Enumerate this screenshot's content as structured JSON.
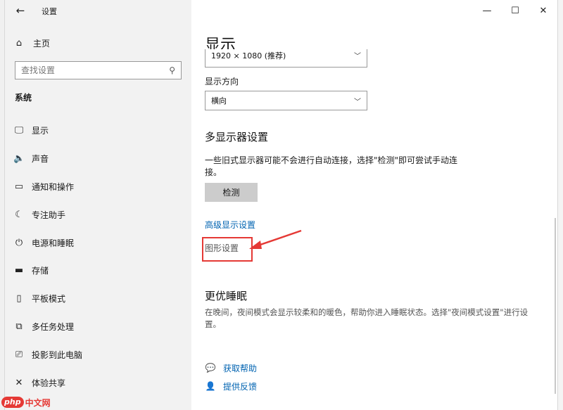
{
  "window": {
    "title": "设置"
  },
  "controls": {
    "minimize": "—",
    "maximize": "☐",
    "close": "✕"
  },
  "sidebar": {
    "home_label": "主页",
    "search_placeholder": "查找设置",
    "section": "系统",
    "items": [
      {
        "label": "显示",
        "icon": "monitor-icon",
        "glyph": "🖵"
      },
      {
        "label": "声音",
        "icon": "speaker-icon",
        "glyph": "🔈"
      },
      {
        "label": "通知和操作",
        "icon": "notification-icon",
        "glyph": "▭"
      },
      {
        "label": "专注助手",
        "icon": "moon-icon",
        "glyph": "☾"
      },
      {
        "label": "电源和睡眠",
        "icon": "power-icon",
        "glyph": "⏻"
      },
      {
        "label": "存储",
        "icon": "storage-icon",
        "glyph": "▬"
      },
      {
        "label": "平板模式",
        "icon": "tablet-icon",
        "glyph": "▯"
      },
      {
        "label": "多任务处理",
        "icon": "multitask-icon",
        "glyph": "⧉"
      },
      {
        "label": "投影到此电脑",
        "icon": "project-icon",
        "glyph": "⎚"
      },
      {
        "label": "体验共享",
        "icon": "share-icon",
        "glyph": "✕"
      }
    ]
  },
  "main": {
    "title": "显示",
    "resolution_value": "1920 × 1080 (推荐)",
    "orientation_label": "显示方向",
    "orientation_value": "横向",
    "multi_title": "多显示器设置",
    "multi_desc": "一些旧式显示器可能不会进行自动连接，选择\"检测\"即可尝试手动连接。",
    "detect_label": "检测",
    "advanced_link": "高级显示设置",
    "graphics_link": "图形设置",
    "sleep_title": "更优睡眠",
    "sleep_desc": "在晚间，夜间模式会显示较柔和的暖色，帮助你进入睡眠状态。选择\"夜间模式设置\"进行设置。",
    "help_label": "获取帮助",
    "feedback_label": "提供反馈"
  },
  "watermark": {
    "php": "php",
    "cn": "中文网"
  },
  "colors": {
    "accent": "#0078d7",
    "link": "#0063b1",
    "highlight": "#e53935"
  }
}
